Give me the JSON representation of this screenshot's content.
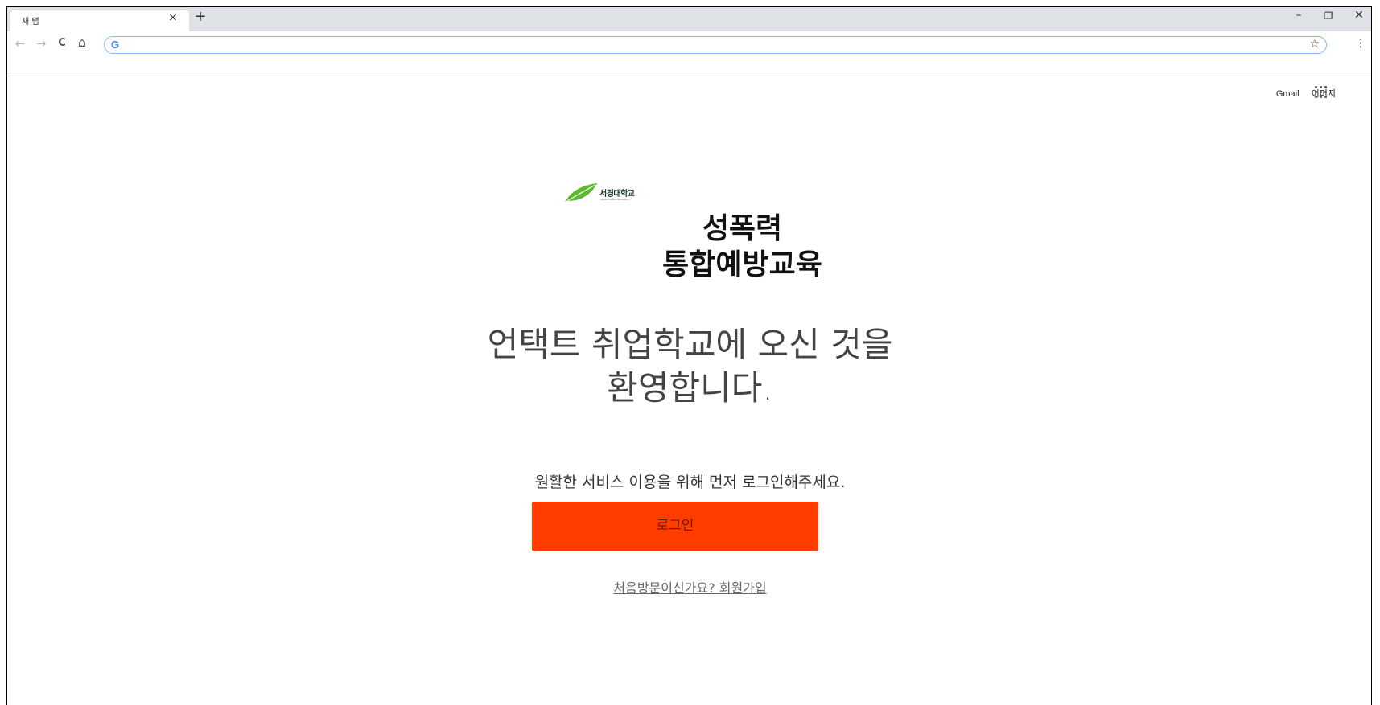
{
  "browser": {
    "tab_title": "새 탭",
    "tab_close": "×",
    "new_tab": "+",
    "window_minimize": "–",
    "window_restore": "❐",
    "window_close": "✕",
    "back": "←",
    "forward": "→",
    "reload": "C",
    "home": "⌂",
    "omnibox_google_icon": "G",
    "omnibox_value": "",
    "bookmark_star": "☆",
    "menu": "⋮"
  },
  "google_bar": {
    "gmail": "Gmail",
    "images": "이미지"
  },
  "logo": {
    "name": "서경대학교",
    "sub": "SEOKYEONG UNIVERSITY",
    "leaf_color": "#5cb82e"
  },
  "page": {
    "title_line1": "성폭력",
    "title_line2": "통합예방교육",
    "welcome_line1": "언택트 취업학교에 오신 것을",
    "welcome_line2": "환영합니다.",
    "instruction": "원활한 서비스 이용을 위해 먼저 로그인해주세요.",
    "login_button": "로그인",
    "signup_link": "처음방문이신가요? 회원가입"
  },
  "colors": {
    "accent": "#ff3d00",
    "omnibox_border": "#8ab4f8",
    "tabstrip": "#dee1e6"
  }
}
